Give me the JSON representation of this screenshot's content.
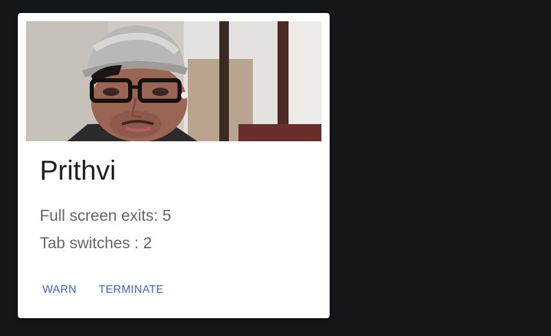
{
  "student": {
    "name": "Prithvi",
    "full_screen_exits_label": "Full screen exits: 5",
    "full_screen_exits": 5,
    "tab_switches_label": "Tab switches : 2",
    "tab_switches": 2
  },
  "actions": {
    "warn_label": "WARN",
    "terminate_label": "TERMINATE"
  },
  "colors": {
    "background": "#141719",
    "card": "#ffffff",
    "action_text": "#3565c4"
  }
}
